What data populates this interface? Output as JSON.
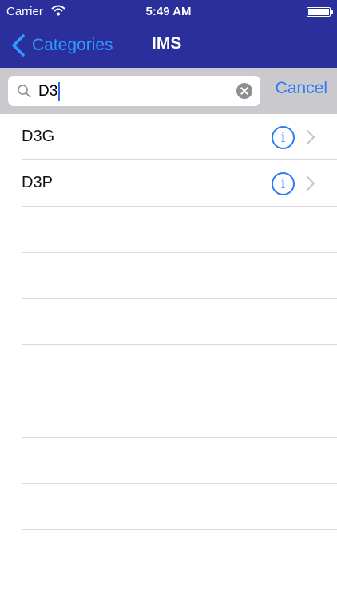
{
  "status_bar": {
    "carrier": "Carrier",
    "time": "5:49 AM"
  },
  "nav_bar": {
    "back_label": "Categories",
    "title": "IMS"
  },
  "search": {
    "value": "D3",
    "cancel_label": "Cancel"
  },
  "results": [
    {
      "label": "D3G",
      "info_icon": "info-icon",
      "chevron_icon": "chevron-right-icon"
    },
    {
      "label": "D3P",
      "info_icon": "info-icon",
      "chevron_icon": "chevron-right-icon"
    }
  ],
  "colors": {
    "nav_background": "#2a2f9c",
    "accent": "#2f7cf6",
    "search_bar_background": "#c9c9ce"
  }
}
